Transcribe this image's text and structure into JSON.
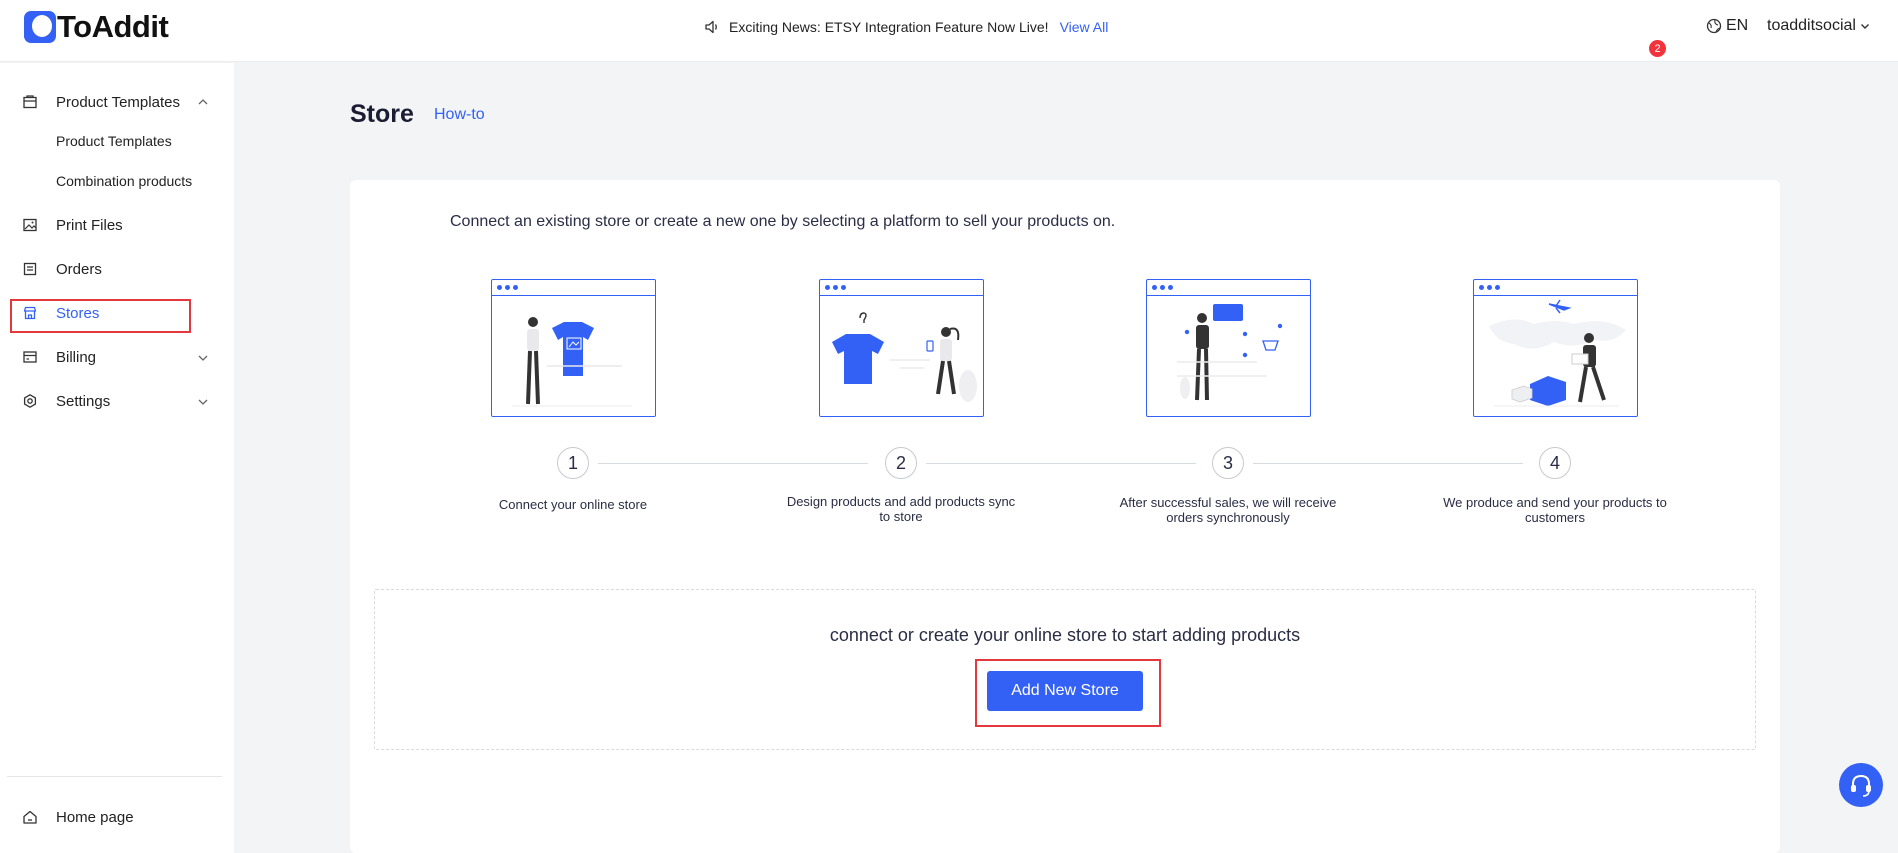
{
  "header": {
    "brand": "ToAddit",
    "news_text": "Exciting News: ETSY Integration Feature Now Live!",
    "news_link": "View All",
    "language": "EN",
    "username": "toadditsocial",
    "notification_count": "2"
  },
  "sidebar": {
    "product_templates": "Product Templates",
    "sub_items": [
      "Product Templates",
      "Combination products"
    ],
    "print_files": "Print Files",
    "orders": "Orders",
    "stores": "Stores",
    "billing": "Billing",
    "settings": "Settings",
    "home": "Home page"
  },
  "main": {
    "title": "Store",
    "howto": "How-to",
    "intro": "Connect an existing store or create a new one by selecting a platform to sell your products on.",
    "steps": [
      {
        "num": "1",
        "line1": "Connect your online store",
        "line2": ""
      },
      {
        "num": "2",
        "line1": "Design products and add products sync",
        "line2": "to store"
      },
      {
        "num": "3",
        "line1": "After successful sales, we will receive",
        "line2": "orders synchronously"
      },
      {
        "num": "4",
        "line1": "We produce and send your products to",
        "line2": "customers"
      }
    ],
    "connect_text": "connect or create your online store to start adding products",
    "add_button": "Add New Store"
  },
  "colors": {
    "accent": "#3461f5",
    "highlight": "#e4393c",
    "badge": "#f2333c"
  }
}
